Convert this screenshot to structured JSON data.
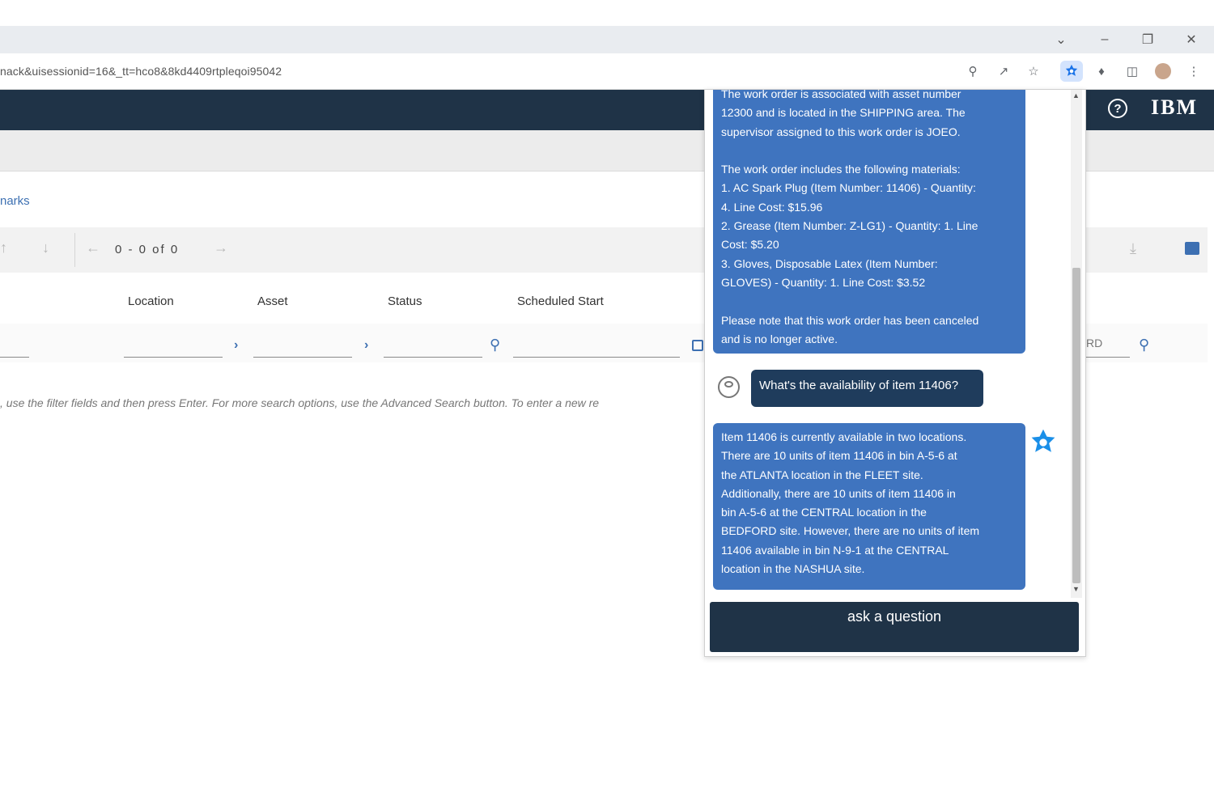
{
  "browser": {
    "url": "nack&uisessionid=16&_tt=hco8&8kd4409rtpleqoi95042",
    "window_controls": [
      "chevron-down",
      "minimize",
      "restore",
      "close"
    ],
    "toolbar_icons": [
      "zoom-icon",
      "share-icon",
      "star-icon",
      "extension-active-icon",
      "puzzle-icon",
      "sidebar-icon",
      "avatar",
      "menu-icon"
    ]
  },
  "app": {
    "brand": "IBM",
    "help_symbol": "?",
    "bookmarks_label": "narks",
    "pager": "0 - 0 of 0",
    "columns": [
      "Location",
      "Asset",
      "Status",
      "Scheduled Start"
    ],
    "partial_filter_text": "RD",
    "hint": ", use the filter fields and then press Enter. For more search options, use the Advanced Search button. To enter a new re"
  },
  "chat": {
    "assistant_message_1": [
      "The work order is associated with asset number",
      "12300 and is located in the SHIPPING area. The",
      "supervisor assigned to this work order is JOEO.",
      "",
      "The work order includes the following materials:",
      "1. AC Spark Plug (Item Number: 11406) - Quantity:",
      "4. Line Cost: $15.96",
      "2. Grease (Item Number: Z-LG1) - Quantity: 1. Line",
      "Cost: $5.20",
      "3. Gloves, Disposable Latex (Item Number:",
      "GLOVES) - Quantity: 1. Line Cost: $3.52",
      "",
      "Please note that this work order has been canceled",
      "and is no longer active."
    ],
    "user_message": "What's the availability of item 11406?",
    "assistant_message_2": [
      "Item 11406 is currently available in two locations.",
      "There are 10 units of item 11406 in bin A-5-6 at",
      "the ATLANTA location in the FLEET site.",
      "Additionally, there are 10 units of item 11406 in",
      "bin A-5-6 at the CENTRAL location in the",
      "BEDFORD site. However, there are no units of item",
      "11406 available in bin N-9-1 at the CENTRAL",
      "location in the NASHUA site."
    ],
    "input_placeholder": "ask a question"
  },
  "colors": {
    "header": "#1f3347",
    "assistant_bubble": "#3f74bf",
    "user_bubble": "#1f3c5c",
    "link": "#3d70b2"
  }
}
